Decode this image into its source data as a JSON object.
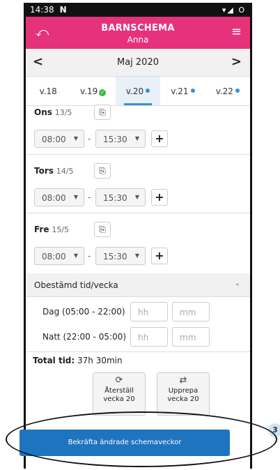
{
  "status": {
    "time": "14:38",
    "carrier": "N",
    "icons": "▾◢ O"
  },
  "header": {
    "back_icon": "undo-arrow",
    "title": "BARNSCHEMA",
    "subtitle": "Anna",
    "menu_icon": "hamburger"
  },
  "month": {
    "prev": "<",
    "label": "Maj 2020",
    "next": ">"
  },
  "weeks": [
    {
      "label": "v.18",
      "marker": "none"
    },
    {
      "label": "v.19",
      "marker": "check"
    },
    {
      "label": "v.20",
      "marker": "dot",
      "active": true
    },
    {
      "label": "v.21",
      "marker": "dot"
    },
    {
      "label": "v.22",
      "marker": "dot"
    }
  ],
  "days": [
    {
      "name": "Ons",
      "date": "13/5",
      "start": "08:00",
      "end": "15:30",
      "separator": "-",
      "plus": "+"
    },
    {
      "name": "Tors",
      "date": "14/5",
      "start": "08:00",
      "end": "15:30",
      "separator": "-",
      "plus": "+"
    },
    {
      "name": "Fre",
      "date": "15/5",
      "start": "08:00",
      "end": "15:30",
      "separator": "-",
      "plus": "+"
    }
  ],
  "unscheduled": {
    "label": "Obestämd tid/vecka",
    "rows": [
      {
        "label": "Dag (05:00 - 22:00)",
        "hh": "hh",
        "mm": "mm"
      },
      {
        "label": "Natt (22:00 - 05:00)",
        "hh": "hh",
        "mm": "mm"
      }
    ]
  },
  "total": {
    "label": "Total tid:",
    "value": "37h 30min"
  },
  "actions": {
    "reset": {
      "line1": "Återställ",
      "line2": "vecka 20"
    },
    "repeat": {
      "line1": "Upprepa",
      "line2": "vecka 20"
    }
  },
  "confirm": {
    "label": "Bekräfta ändrade schemaveckor",
    "badge": "3"
  },
  "colors": {
    "header": "#e5327a",
    "accent": "#1f74bf",
    "check": "#3cb54a"
  }
}
